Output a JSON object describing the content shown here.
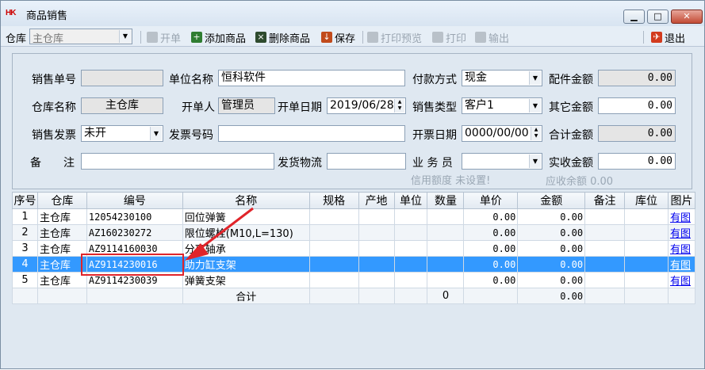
{
  "window": {
    "logo": "HK",
    "title": "商品销售",
    "min": "▁",
    "max": "□",
    "close": "✕"
  },
  "toolbar": {
    "warehouse_label": "仓库",
    "warehouse_value": "主仓库",
    "open_label": "开单",
    "add_label": "添加商品",
    "delete_label": "删除商品",
    "save_label": "保存",
    "preview_label": "打印预览",
    "print_label": "打印",
    "export_label": "输出",
    "exit_label": "退出"
  },
  "form": {
    "order_no_label": "销售单号",
    "order_no": "",
    "unit_label": "单位名称",
    "unit": "恒科软件",
    "pay_label": "付款方式",
    "pay": "现金",
    "parts_label": "配件金额",
    "parts": "0.00",
    "wh_label": "仓库名称",
    "wh": "主仓库",
    "opener_label": "开单人",
    "opener": "管理员",
    "date_label": "开单日期",
    "date": "2019/06/28",
    "type_label": "销售类型",
    "type": "客户1",
    "other_label": "其它金额",
    "other": "0.00",
    "invoice_label": "销售发票",
    "invoice": "未开",
    "invoice_no_label": "发票号码",
    "invoice_no": "",
    "inv_date_label": "开票日期",
    "inv_date": "0000/00/00",
    "total_label": "合计金额",
    "total": "0.00",
    "remark_label": "备　　注",
    "remark": "",
    "logistics_label": "发货物流",
    "logistics": "",
    "salesman_label": "业 务 员",
    "salesman": "",
    "received_label": "实收金额",
    "received": "0.00",
    "credit_hint": "信用额度  未设置!",
    "receivable_hint": "应收余额  0.00"
  },
  "grid": {
    "headers": [
      "序号",
      "仓库",
      "编号",
      "名称",
      "规格",
      "产地",
      "单位",
      "数量",
      "单价",
      "金额",
      "备注",
      "库位",
      "图片"
    ],
    "rows": [
      [
        "1",
        "主仓库",
        "12054230100",
        "回位弹簧",
        "",
        "",
        "",
        "",
        "0.00",
        "0.00",
        "",
        "",
        "有图"
      ],
      [
        "2",
        "主仓库",
        "AZ160230272",
        "限位螺栓(M10,L=130)",
        "",
        "",
        "",
        "",
        "0.00",
        "0.00",
        "",
        "",
        "有图"
      ],
      [
        "3",
        "主仓库",
        "AZ9114160030",
        "分离轴承",
        "",
        "",
        "",
        "",
        "0.00",
        "0.00",
        "",
        "",
        "有图"
      ],
      [
        "4",
        "主仓库",
        "AZ9114230016",
        "助力缸支架",
        "",
        "",
        "",
        "",
        "0.00",
        "0.00",
        "",
        "",
        "有图"
      ],
      [
        "5",
        "主仓库",
        "AZ9114230039",
        "弹簧支架",
        "",
        "",
        "",
        "",
        "0.00",
        "0.00",
        "",
        "",
        "有图"
      ]
    ],
    "total_label": "合计",
    "total_qty": "0",
    "total_amount": "0.00"
  }
}
